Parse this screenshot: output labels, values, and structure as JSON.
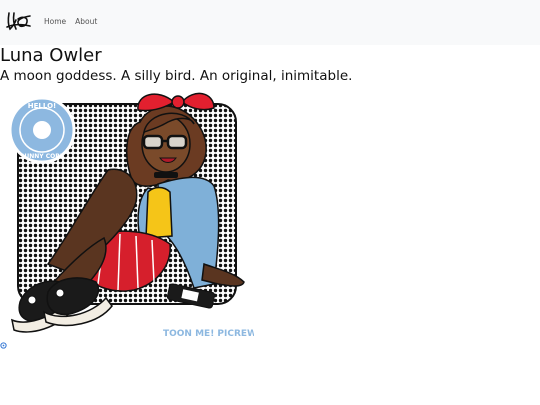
{
  "navbar": {
    "logo_icon": "signature-logo-icon",
    "links": [
      {
        "label": "Home"
      },
      {
        "label": "About"
      }
    ],
    "background": "#f8f9fa"
  },
  "profile": {
    "name": "Luna Owler",
    "tagline": "A moon goddess. A silly bird. An original, inimitable."
  },
  "artwork": {
    "badge_text": "HELLO! SUNNY CORE",
    "credit_text": "TOON ME! PICREW",
    "accent_colors": {
      "bow": "#e2202f",
      "jacket": "#7fb0d8",
      "top": "#f5c518",
      "skirt": "#d61f2c",
      "badge": "#8db8e0"
    }
  },
  "footer_icon": "link-icon"
}
